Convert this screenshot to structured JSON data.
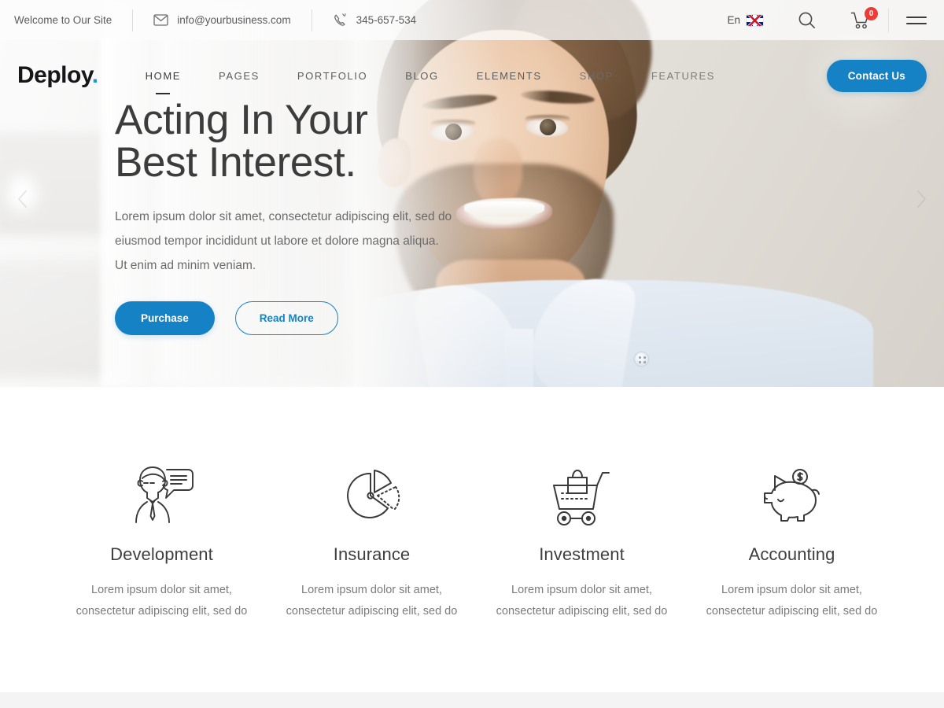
{
  "topbar": {
    "welcome": "Welcome to Our Site",
    "email": "info@yourbusiness.com",
    "email_icon": "envelope-icon",
    "phone": "345-657-534",
    "phone_icon": "phone-icon",
    "language": "En",
    "flag_icon": "uk-flag-icon",
    "search_icon": "search-icon",
    "cart_icon": "cart-icon",
    "cart_count": "0",
    "menu_icon": "hamburger-menu-icon"
  },
  "nav": {
    "logo_text": "Deploy",
    "logo_dot": ".",
    "items": [
      {
        "label": "HOME",
        "active": true
      },
      {
        "label": "PAGES",
        "active": false
      },
      {
        "label": "PORTFOLIO",
        "active": false
      },
      {
        "label": "BLOG",
        "active": false
      },
      {
        "label": "ELEMENTS",
        "active": false
      },
      {
        "label": "SHOP",
        "active": false
      },
      {
        "label": "FEATURES",
        "active": false
      }
    ],
    "contact_label": "Contact Us"
  },
  "hero": {
    "title": "Acting In Your\nBest Interest.",
    "paragraph": "Lorem ipsum dolor sit amet, consectetur adipiscing elit, sed do eiusmod tempor incididunt ut labore et dolore magna aliqua. Ut enim ad minim veniam.",
    "primary_button": "Purchase",
    "secondary_button": "Read More",
    "prev_arrow_icon": "chevron-left-icon",
    "next_arrow_icon": "chevron-right-icon"
  },
  "services": [
    {
      "icon": "consultant-speech-bubble-icon",
      "title": "Development",
      "desc": "Lorem ipsum dolor sit amet, consectetur adipiscing elit, sed do"
    },
    {
      "icon": "pie-chart-icon",
      "title": "Insurance",
      "desc": "Lorem ipsum dolor sit amet, consectetur adipiscing elit, sed do"
    },
    {
      "icon": "shopping-cart-bag-icon",
      "title": "Investment",
      "desc": "Lorem ipsum dolor sit amet, consectetur adipiscing elit, sed do"
    },
    {
      "icon": "piggy-bank-icon",
      "title": "Accounting",
      "desc": "Lorem ipsum dolor sit amet, consectetur adipiscing elit, sed do"
    }
  ],
  "colors": {
    "accent_blue": "#1682c6",
    "logo_dot_blue": "#1f9bd1",
    "badge_red": "#ef3b36",
    "heading_gray": "#3c3c3c",
    "body_gray": "#6b6b6b",
    "icon_stroke": "#3a3a3a"
  }
}
